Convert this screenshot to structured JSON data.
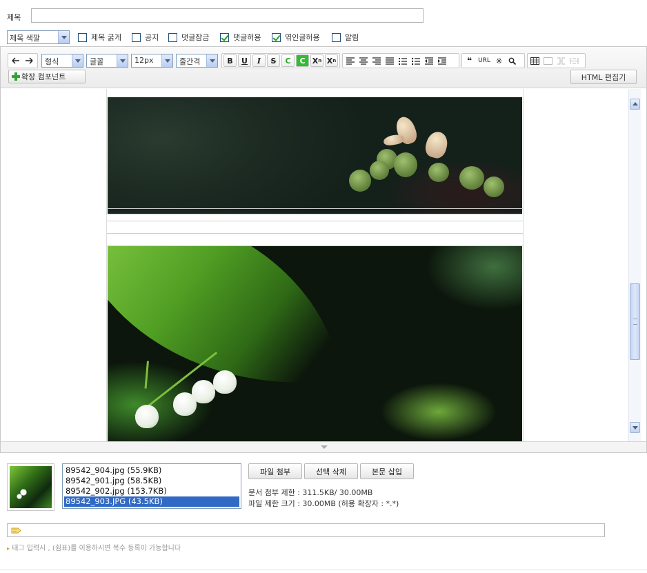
{
  "post": {
    "title_label": "제목",
    "title_value": "",
    "color_select": "제목 색깔",
    "options": [
      {
        "label": "제목 굵게",
        "checked": false
      },
      {
        "label": "공지",
        "checked": false
      },
      {
        "label": "댓글잠금",
        "checked": false
      },
      {
        "label": "댓글허용",
        "checked": true
      },
      {
        "label": "엮인글허용",
        "checked": true
      },
      {
        "label": "알림",
        "checked": false
      }
    ]
  },
  "toolbar": {
    "undo_icon": "arrow-left-icon",
    "redo_icon": "arrow-right-icon",
    "format_select": "형식",
    "font_select": "글꼴",
    "size_select": "12px",
    "lineheight_select": "줄간격",
    "bold": "B",
    "underline": "U",
    "italic": "I",
    "strike": "S",
    "font_color": "C",
    "bg_color": "C",
    "superscript": "X",
    "subscript": "X",
    "quote": "❝",
    "url": "URL",
    "special_char": "※",
    "search": "⚲",
    "extend_component": "확장 컴포넌트",
    "html_editor": "HTML 편집기"
  },
  "attachments": {
    "files": [
      {
        "name": "89542_904.jpg (55.9KB)",
        "selected": false
      },
      {
        "name": "89542_901.jpg (58.5KB)",
        "selected": false
      },
      {
        "name": "89542_902.jpg (153.7KB)",
        "selected": false
      },
      {
        "name": "89542_903.JPG (43.5KB)",
        "selected": true
      }
    ],
    "attach_button": "파일 첨부",
    "delete_button": "선택 삭제",
    "insert_button": "본문 삽입",
    "doc_limit": "문서 첨부 제한 : 311.5KB/ 30.00MB",
    "file_limit": "파일 제한 크기 : 30.00MB (허용 확장자 : *.*)"
  },
  "tags": {
    "value": "",
    "hint": "태그 입력시 , (쉼표)를 이용하시면 복수 등록이 가능합니다"
  },
  "colors": {
    "selection": "#316ac5",
    "checkbox_check": "#21a121",
    "accent_green": "#2fa52f"
  }
}
